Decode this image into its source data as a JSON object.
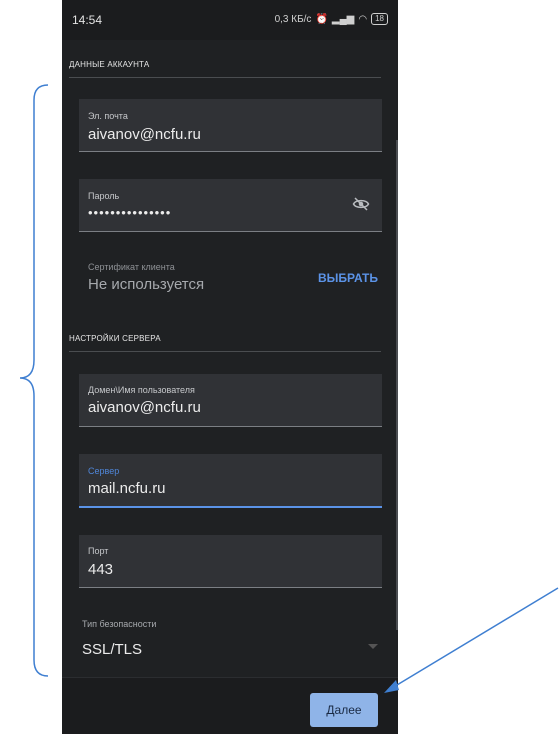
{
  "status_bar": {
    "time": "14:54",
    "network_speed": "0,3 КБ/с",
    "battery": "18",
    "icons": [
      "alarm-icon",
      "signal-icon",
      "wifi-icon",
      "battery-icon"
    ]
  },
  "account_section": {
    "title": "ДАННЫЕ АККАУНТА",
    "email": {
      "label": "Эл. почта",
      "value": "aivanov@ncfu.ru"
    },
    "password": {
      "label": "Пароль",
      "value": "•••••••••••••••",
      "icon": "eye-off-icon"
    },
    "certificate": {
      "label": "Сертификат клиента",
      "value": "Не используется",
      "action": "ВЫБРАТЬ"
    }
  },
  "server_section": {
    "title": "НАСТРОЙКИ СЕРВЕРА",
    "username": {
      "label": "Домен\\Имя пользователя",
      "value": "aivanov@ncfu.ru"
    },
    "server": {
      "label": "Сервер",
      "value": "mail.ncfu.ru"
    },
    "port": {
      "label": "Порт",
      "value": "443"
    },
    "security": {
      "label": "Тип безопасности",
      "value": "SSL/TLS"
    }
  },
  "footer": {
    "next_label": "Далее"
  },
  "colors": {
    "accent": "#5b93e7",
    "background": "#1f2123",
    "field": "#303236",
    "annotation": "#3f7fd1"
  }
}
